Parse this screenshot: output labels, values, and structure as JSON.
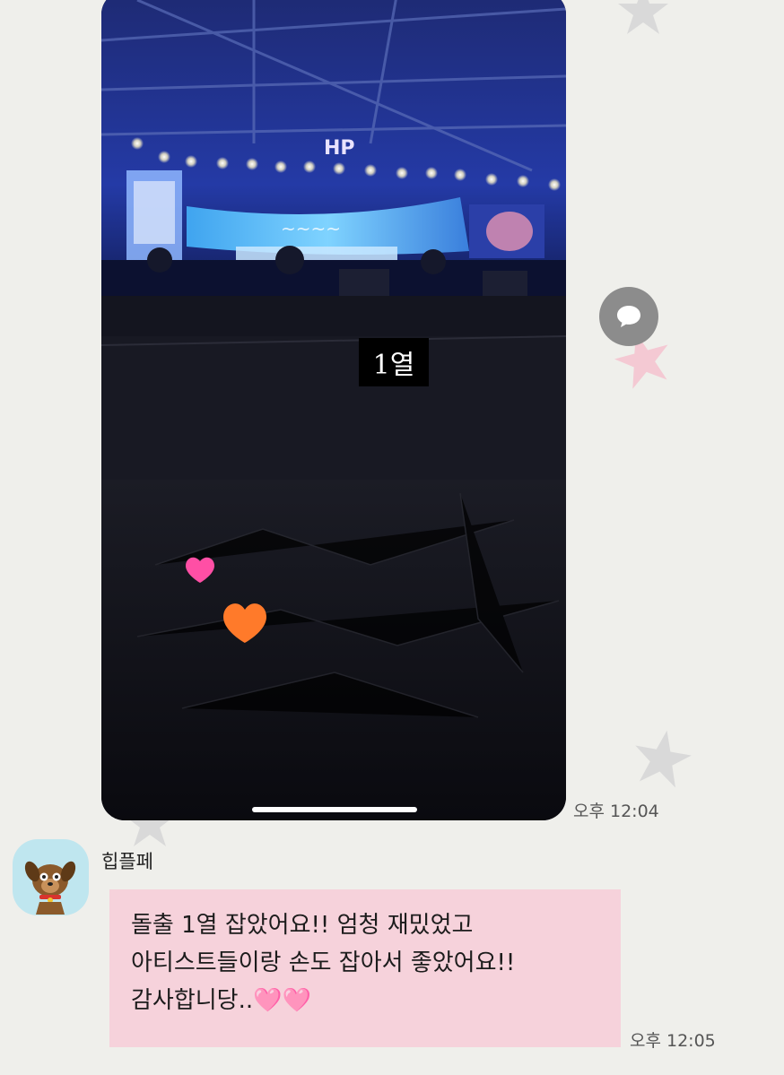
{
  "photo_message": {
    "image_caption": "1열",
    "stage_logo_text": "HP",
    "timestamp": "오후 12:04"
  },
  "share_button": {
    "icon": "speech-bubble-icon"
  },
  "reply_message": {
    "sender_name": "힙플페",
    "avatar_icon": "dog-character-icon",
    "lines": [
      "돌출 1열 잡았어요!! 엄청 재밌었고",
      "아티스트들이랑 손도 잡아서 좋았어요!!",
      "감사합니당.."
    ],
    "emoji": "🩷🩷",
    "timestamp": "오후 12:05"
  },
  "colors": {
    "background": "#efefeb",
    "bubble": "#f6d2db",
    "decor_star_gray": "#d9d9d9",
    "decor_star_pink": "#f4c9d3"
  }
}
